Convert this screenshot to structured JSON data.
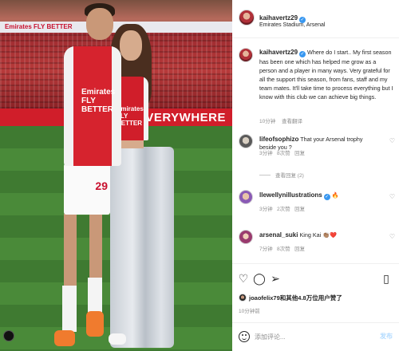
{
  "photo": {
    "banner_text": "Emirates FLY BETTER",
    "adboard_text": "VERYWHERE",
    "shirt_sponsor": "Emirates FLY BETTER",
    "shirt_number": "29",
    "women_shirt_sponsor": "Emirates FLY BETTER"
  },
  "header": {
    "username": "kaihavertz29",
    "location": "Emirates Stadium, Arsenal"
  },
  "caption": {
    "username": "kaihavertz29",
    "text": "Where do I start.. My first season has been one which has helped me grow as a person and a player in many ways. Very grateful for all the support this season, from fans, staff and my team mates. It'll take time to process everything but I know with this club we can achieve big things.",
    "time": "10分钟",
    "translate": "查看翻译"
  },
  "comments": [
    {
      "username": "lifeofsophizo",
      "text": "That your Arsenal trophy beside you ?",
      "time": "3分钟",
      "likes": "8次赞",
      "reply": "回复"
    },
    {
      "username": "llewellynillustrations",
      "text": "🔥",
      "time": "3分钟",
      "likes": "2次赞",
      "reply": "回复"
    },
    {
      "username": "arsenal_suki",
      "text": "King Kai 👏🏽❤️",
      "time": "7分钟",
      "likes": "8次赞",
      "reply": "回复"
    }
  ],
  "replies_label": "查看回复 (2)",
  "likes_text": "joaofelix79和其他4.8万位用户赞了",
  "posted_time": "10分钟前",
  "add_comment": {
    "placeholder": "添加评论...",
    "send_label": "发布"
  },
  "icons": {
    "like": "heart-icon",
    "comment": "comment-icon",
    "share": "share-icon",
    "save": "bookmark-icon"
  }
}
